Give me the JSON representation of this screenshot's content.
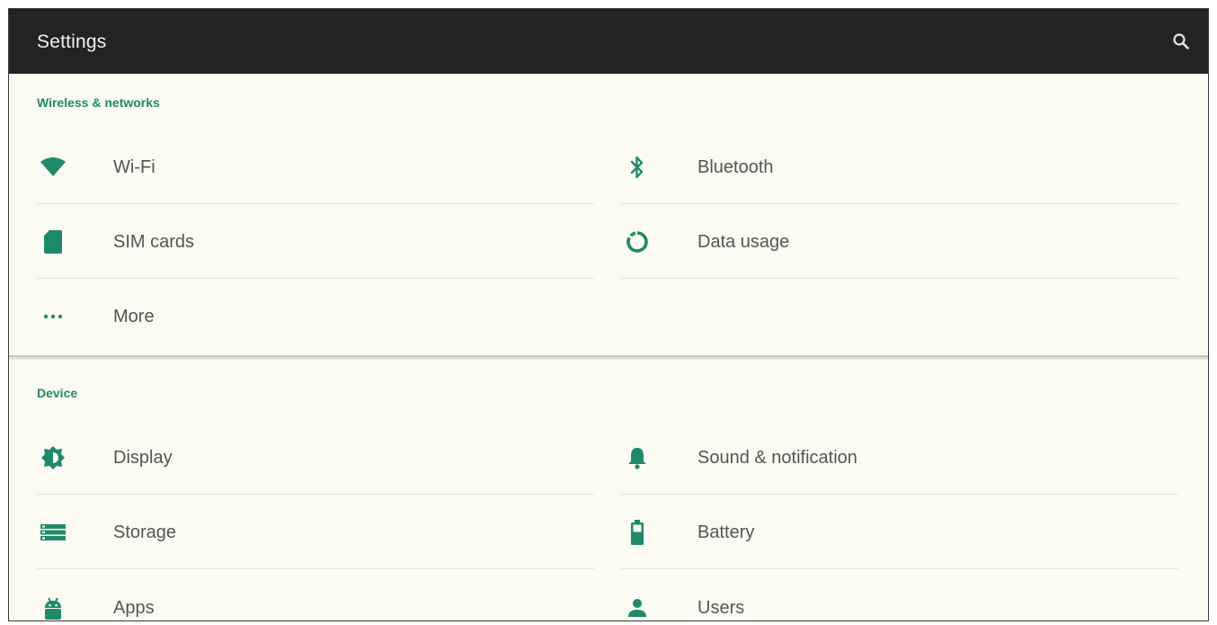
{
  "appbar": {
    "title": "Settings",
    "search_icon": "search-icon"
  },
  "colors": {
    "appbar": "#232323",
    "background": "#fbfbf1",
    "accent": "#1f8a6b",
    "label_text": "#555555"
  },
  "sections": [
    {
      "header": "Wireless & networks",
      "items": [
        {
          "label": "Wi-Fi",
          "icon": "wifi-icon"
        },
        {
          "label": "Bluetooth",
          "icon": "bluetooth-icon"
        },
        {
          "label": "SIM cards",
          "icon": "sim-card-icon"
        },
        {
          "label": "Data usage",
          "icon": "data-usage-icon"
        },
        {
          "label": "More",
          "icon": "more-icon"
        }
      ]
    },
    {
      "header": "Device",
      "items": [
        {
          "label": "Display",
          "icon": "display-brightness-icon"
        },
        {
          "label": "Sound & notification",
          "icon": "bell-icon"
        },
        {
          "label": "Storage",
          "icon": "storage-icon"
        },
        {
          "label": "Battery",
          "icon": "battery-icon"
        },
        {
          "label": "Apps",
          "icon": "android-icon"
        },
        {
          "label": "Users",
          "icon": "person-icon"
        }
      ]
    }
  ]
}
